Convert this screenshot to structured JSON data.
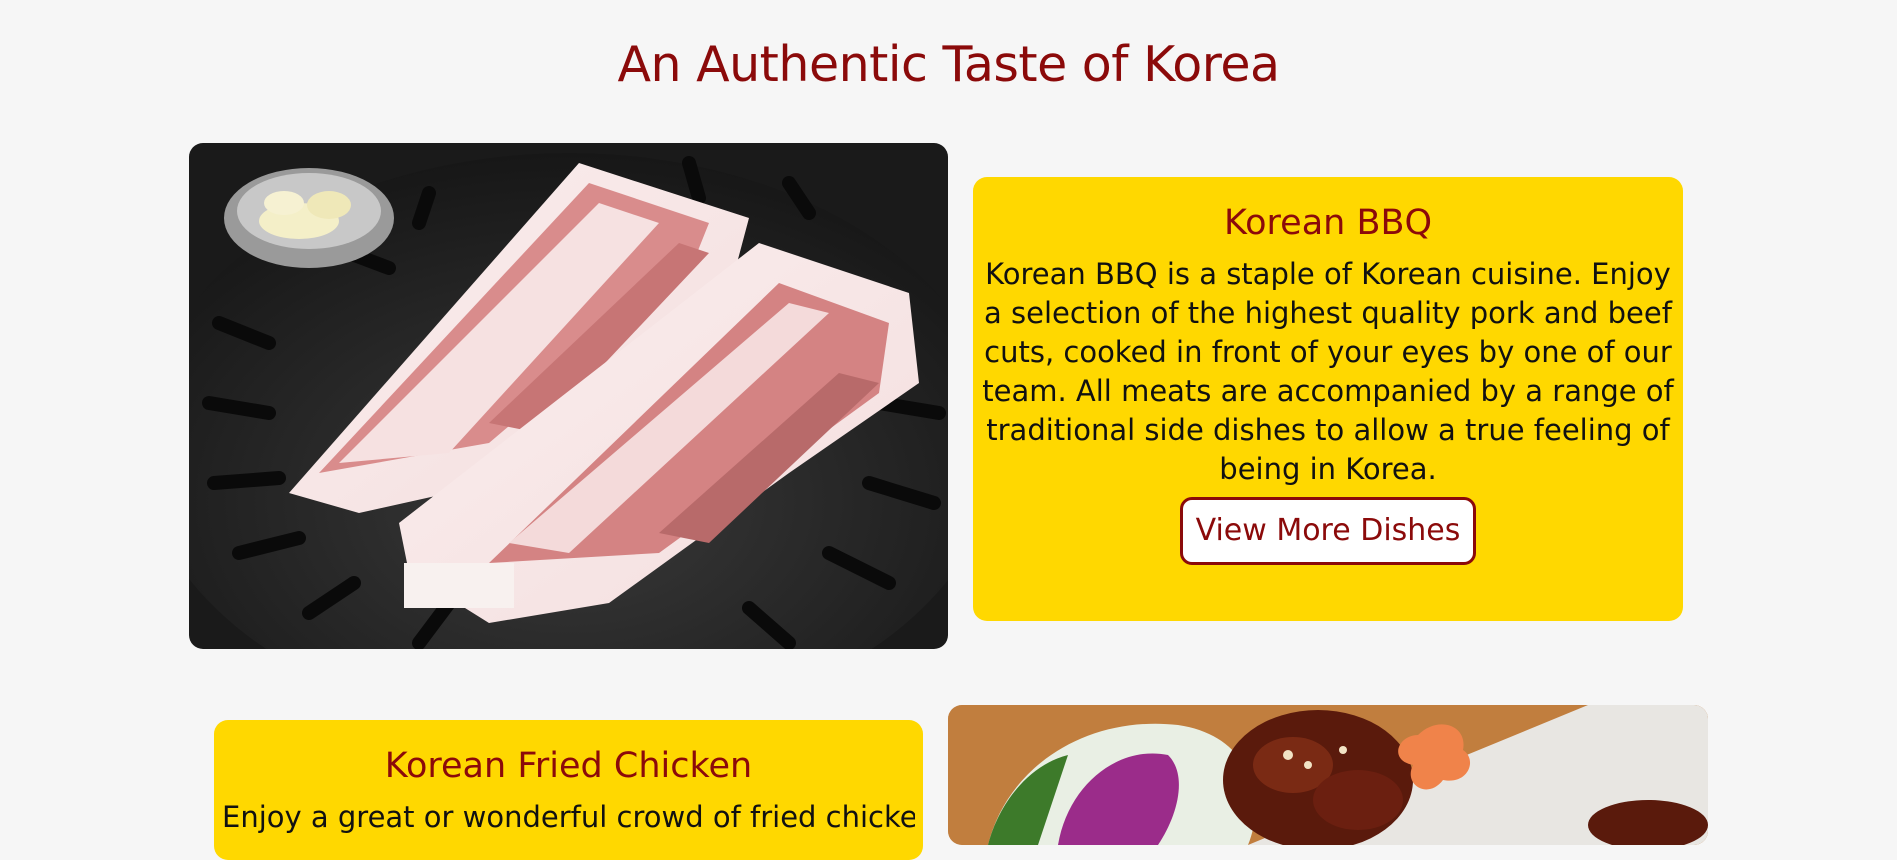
{
  "page": {
    "title": "An Authentic Taste of Korea"
  },
  "sections": [
    {
      "title": "Korean BBQ",
      "description": "Korean BBQ is a staple of Korean cuisine. Enjoy a selection of the highest quality pork and beef cuts, cooked in front of your eyes by one of our team. All meats are accompanied by a range of traditional side dishes to allow a true feeling of being in Korea.",
      "button_label": "View More Dishes"
    },
    {
      "title": "Korean Fried Chicken",
      "description": "Enjoy a great or wonderful crowd of fried chicken"
    }
  ],
  "colors": {
    "background": "#f6f6f6",
    "heading": "#8b0a0a",
    "card": "#ffd800"
  }
}
